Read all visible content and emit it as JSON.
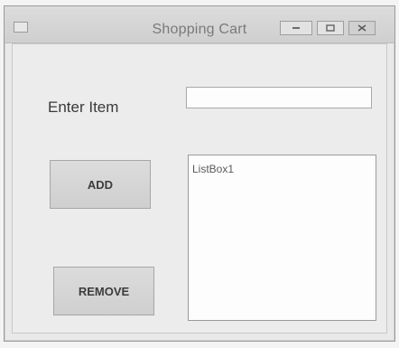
{
  "window": {
    "title": "Shopping Cart"
  },
  "form": {
    "enter_label": "Enter Item",
    "item_input_value": "",
    "add_label": "ADD",
    "remove_label": "REMOVE",
    "listbox_name": "ListBox1"
  },
  "icons": {
    "app": "app-icon",
    "minimize": "minimize-icon",
    "maximize": "maximize-icon",
    "close": "close-icon"
  }
}
